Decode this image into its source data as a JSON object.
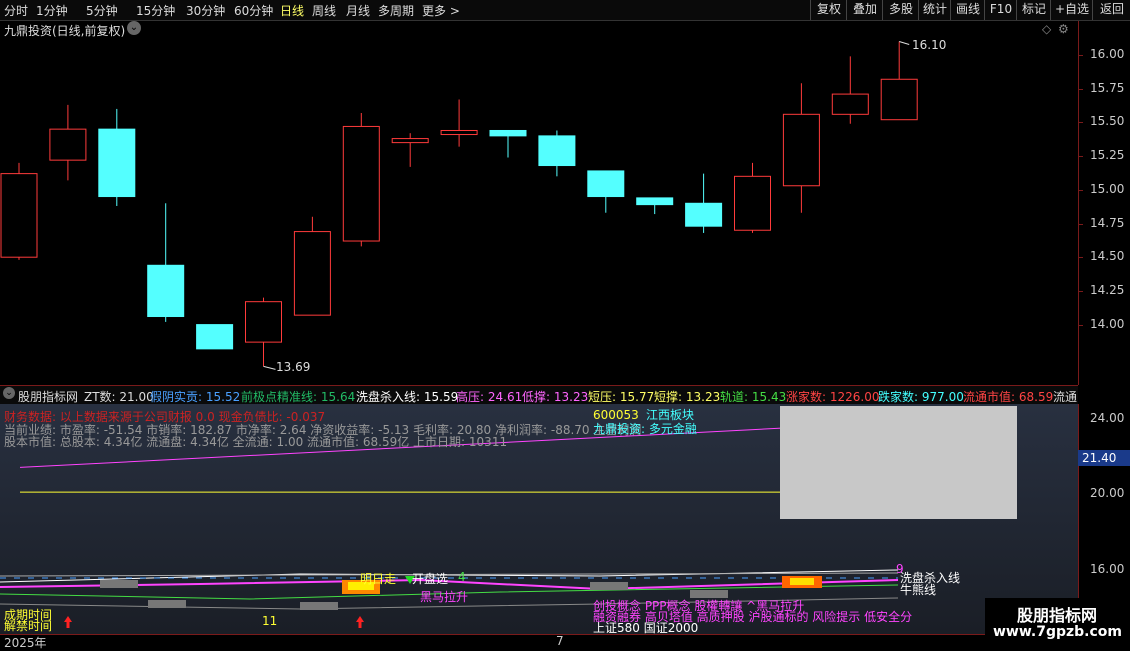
{
  "toolbar": {
    "periods": [
      {
        "label": "分时",
        "active": false
      },
      {
        "label": "1分钟",
        "active": false
      },
      {
        "label": "5分钟",
        "active": false
      },
      {
        "label": "15分钟",
        "active": false
      },
      {
        "label": "30分钟",
        "active": false
      },
      {
        "label": "60分钟",
        "active": false
      },
      {
        "label": "日线",
        "active": true
      },
      {
        "label": "周线",
        "active": false
      },
      {
        "label": "月线",
        "active": false
      },
      {
        "label": "多周期",
        "active": false
      },
      {
        "label": "更多 >",
        "active": false
      }
    ],
    "right_buttons": [
      "复权",
      "叠加",
      "多股",
      "统计",
      "画线",
      "F10",
      "标记",
      "+自选",
      "返回"
    ]
  },
  "main_chart": {
    "title": "九鼎投资(日线,前复权)",
    "high_label": "16.10",
    "low_label": "13.69",
    "price_axis": [
      "16.00",
      "15.75",
      "15.50",
      "15.25",
      "15.00",
      "14.75",
      "14.50",
      "14.25",
      "14.00"
    ],
    "candles": [
      {
        "o": 14.5,
        "h": 15.2,
        "l": 14.48,
        "c": 15.12
      },
      {
        "o": 15.22,
        "h": 15.63,
        "l": 15.07,
        "c": 15.45
      },
      {
        "o": 15.45,
        "h": 15.6,
        "l": 14.88,
        "c": 14.95
      },
      {
        "o": 14.44,
        "h": 14.9,
        "l": 14.02,
        "c": 14.06
      },
      {
        "o": 14.0,
        "h": 14.0,
        "l": 13.87,
        "c": 13.82
      },
      {
        "o": 13.87,
        "h": 14.2,
        "l": 13.69,
        "c": 14.17
      },
      {
        "o": 14.07,
        "h": 14.8,
        "l": 14.07,
        "c": 14.69
      },
      {
        "o": 14.62,
        "h": 15.57,
        "l": 14.58,
        "c": 15.47
      },
      {
        "o": 15.35,
        "h": 15.42,
        "l": 15.17,
        "c": 15.38
      },
      {
        "o": 15.41,
        "h": 15.67,
        "l": 15.32,
        "c": 15.44
      },
      {
        "o": 15.44,
        "h": 15.44,
        "l": 15.24,
        "c": 15.4
      },
      {
        "o": 15.4,
        "h": 15.44,
        "l": 15.1,
        "c": 15.18
      },
      {
        "o": 15.14,
        "h": 15.14,
        "l": 14.83,
        "c": 14.95
      },
      {
        "o": 14.94,
        "h": 14.94,
        "l": 14.82,
        "c": 14.89
      },
      {
        "o": 14.9,
        "h": 15.12,
        "l": 14.68,
        "c": 14.73
      },
      {
        "o": 14.7,
        "h": 15.2,
        "l": 14.68,
        "c": 15.1
      },
      {
        "o": 15.03,
        "h": 15.79,
        "l": 14.83,
        "c": 15.56
      },
      {
        "o": 15.56,
        "h": 15.99,
        "l": 15.49,
        "c": 15.71
      },
      {
        "o": 15.52,
        "h": 16.1,
        "l": 15.52,
        "c": 15.82
      }
    ]
  },
  "indicator_bar": {
    "items": [
      {
        "text": "股朋指标网",
        "color": "#dddddd"
      },
      {
        "text": "ZT数: 21.00",
        "color": "#dddddd"
      },
      {
        "text": "假阴实贡: 15.52",
        "color": "#4aa0ff"
      },
      {
        "text": "前极点精准线: 15.64",
        "color": "#22bb66"
      },
      {
        "text": "洗盘杀入线: 15.59",
        "color": "#ffffff"
      },
      {
        "text": "高压: 24.61",
        "color": "#ff66ff"
      },
      {
        "text": "低撑: 13.23",
        "color": "#ff66ff"
      },
      {
        "text": "短压: 15.77",
        "color": "#ffff66"
      },
      {
        "text": "短撑: 13.23",
        "color": "#ffff66"
      },
      {
        "text": "轨道: 15.43",
        "color": "#44dd44"
      },
      {
        "text": "涨家数: 1226.00",
        "color": "#ff4444"
      },
      {
        "text": "跌家数: 977.00",
        "color": "#44ffff"
      },
      {
        "text": "流通市值: 68.59",
        "color": "#ff4444"
      },
      {
        "text": "流通",
        "color": "#dddddd"
      }
    ]
  },
  "panel2": {
    "axis": [
      "24.00",
      "20.00",
      "16.00"
    ],
    "current_value": "21.40",
    "info_lines": [
      "财务数据: 以上数据来源于公司财报 0.0 现金负债比: -0.037",
      "当前业绩: 市盈率: -51.54 市销率: 182.87 市净率: 2.64 净资收益率: -5.13 毛利率: 20.80 净利润率: -88.70 主营利润",
      "股本市值: 总股本: 4.34亿 流通盘: 4.34亿 全流通: 1.00 流通市值: 68.59亿 上市日期: 10311"
    ],
    "stock_code": "600053",
    "stock_region": "江西板块",
    "stock_industry": "九鼎投资: 多元金融",
    "sig_mingri": "明日走",
    "sig_kaipan": "开盘选",
    "sig_4": "4",
    "sig_heima": "黑马拉升",
    "line_xipan": "洗盘杀入线",
    "line_niuxiong": "牛熊线",
    "sig_9": "9",
    "concepts_1": "创投概念 PPP概念 股權轉讓 ^黑马拉升",
    "concepts_2": "融资融券 高贝塔值 高质押股 沪股通标的 风险提示 低安全分",
    "index_line": "上证580 国证2000",
    "deal_time": "成期时间",
    "jiejin": "解禁时间",
    "year": "2025年",
    "x_tick_11": "11",
    "x_tick_7": "7"
  },
  "watermark": {
    "title": "股朋指标网",
    "url": "www.7gpzb.com"
  },
  "colors": {
    "up": "#ff3b3b",
    "down": "#54ffff",
    "magenta": "#ff44ff",
    "yellow": "#ffff33"
  }
}
